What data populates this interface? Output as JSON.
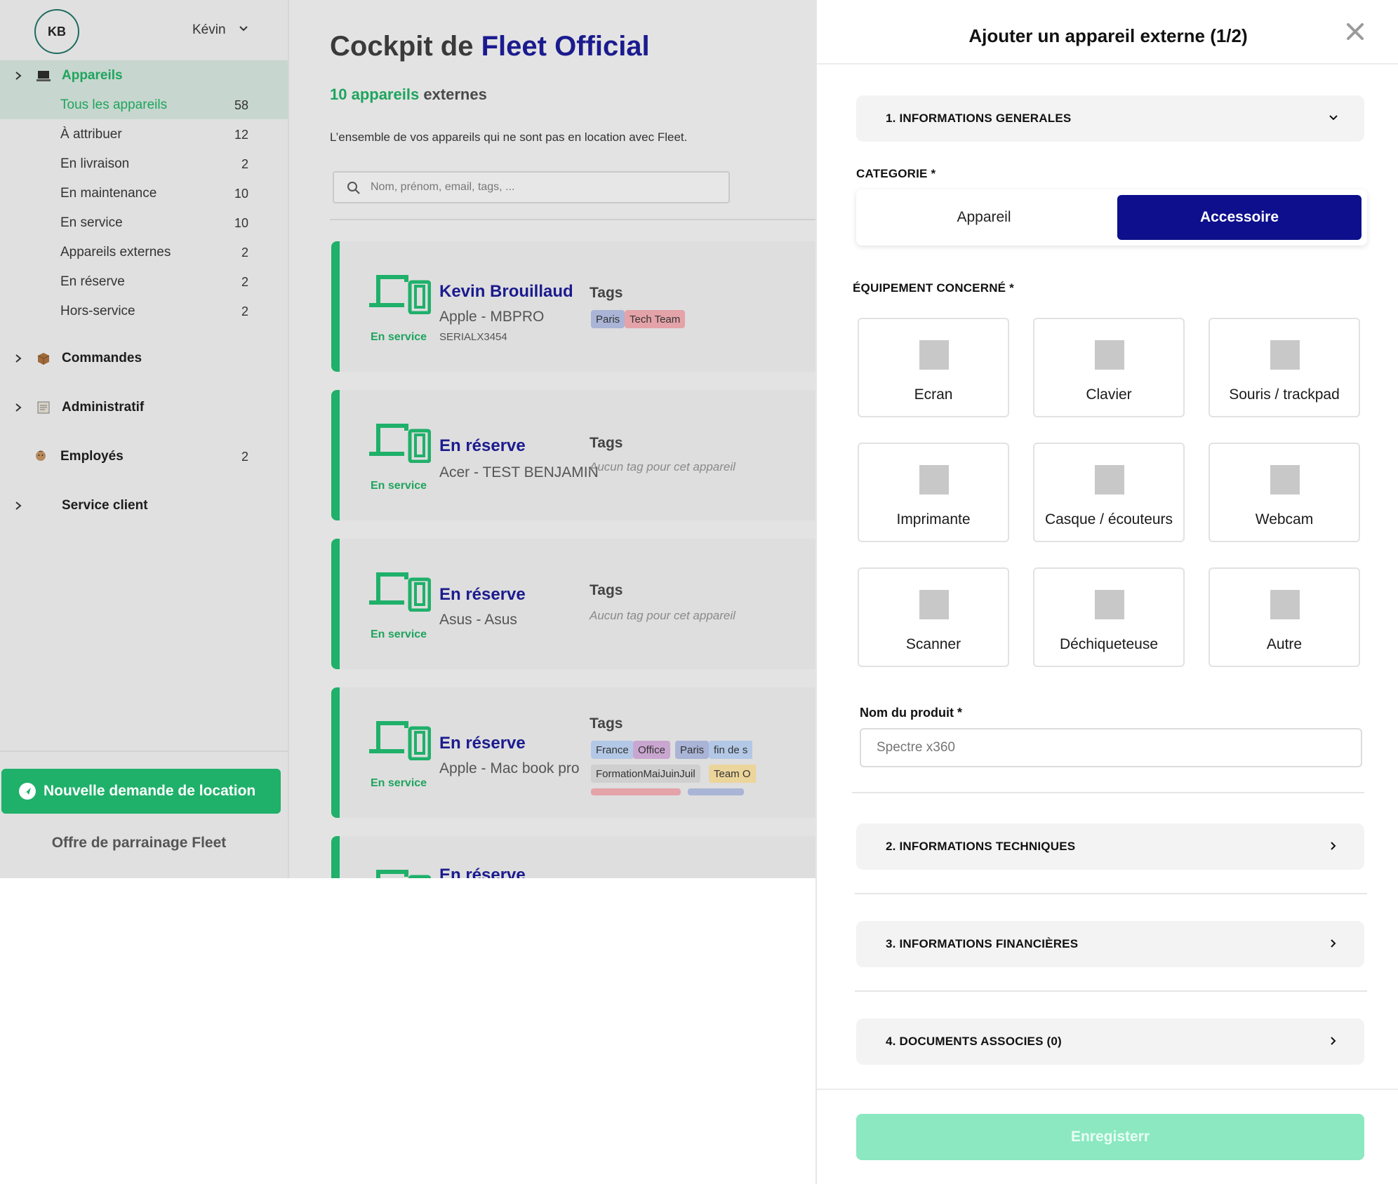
{
  "user": {
    "initials": "KB",
    "name": "Kévin"
  },
  "sidebar": {
    "devices_label": "Appareils",
    "sub_items": [
      {
        "label": "Tous les appareils",
        "count": "58"
      },
      {
        "label": "À attribuer",
        "count": "12"
      },
      {
        "label": "En livraison",
        "count": "2"
      },
      {
        "label": "En maintenance",
        "count": "10"
      },
      {
        "label": "En service",
        "count": "10"
      },
      {
        "label": "Appareils externes",
        "count": "2"
      },
      {
        "label": "En réserve",
        "count": "2"
      },
      {
        "label": "Hors-service",
        "count": "2"
      }
    ],
    "orders_label": "Commandes",
    "admin_label": "Administratif",
    "employees_label": "Employés",
    "employees_count": "2",
    "support_label": "Service client",
    "cta_label": "Nouvelle demande de location",
    "referral_label": "Offre de parrainage Fleet"
  },
  "main": {
    "title_prefix": "Cockpit de",
    "title_brand": "Fleet Official",
    "subtitle_count": "10 appareils",
    "subtitle_rest": "externes",
    "description": "L’ensemble de vos appareils qui ne sont pas en location avec Fleet.",
    "search_placeholder": "Nom, prénom, email, tags, ...",
    "tags_title": "Tags",
    "no_tags": "Aucun tag pour cet appareil",
    "cards": [
      {
        "status": "En service",
        "name": "Kevin Brouillaud",
        "model": "Apple - MBPRO",
        "serial": "SERIALX3454"
      },
      {
        "status": "En service",
        "name": "En réserve",
        "model": "Acer - TEST BENJAMIN"
      },
      {
        "status": "En service",
        "name": "En réserve",
        "model": "Asus - Asus"
      },
      {
        "status": "En service",
        "name": "En réserve",
        "model": "Apple - Mac book pro"
      },
      {
        "name": "En réserve"
      }
    ],
    "card1_tags": [
      "Paris",
      "Tech Team"
    ],
    "card4_tags_row1": [
      "France",
      "Office",
      "Paris",
      "fin de s"
    ],
    "card4_tags_row2": [
      "FormationMaiJuinJuil",
      "Team O"
    ]
  },
  "panel": {
    "title": "Ajouter un appareil externe (1/2)",
    "section1": "1. INFORMATIONS GENERALES",
    "category_label": "CATEGORIE *",
    "category_options": [
      "Appareil",
      "Accessoire"
    ],
    "category_selected": "Accessoire",
    "equipment_label": "ÉQUIPEMENT CONCERNÉ *",
    "equipment": [
      "Ecran",
      "Clavier",
      "Souris / trackpad",
      "Imprimante",
      "Casque / écouteurs",
      "Webcam",
      "Scanner",
      "Déchiqueteuse",
      "Autre"
    ],
    "product_label": "Nom du produit *",
    "product_placeholder": "Spectre x360",
    "section2": "2. INFORMATIONS TECHNIQUES",
    "section3": "3. INFORMATIONS FINANCIÈRES",
    "section4": "4. DOCUMENTS ASSOCIES (0)",
    "save_label": "Enregisterr"
  },
  "colors": {
    "brand_navy": "#0d0f8c",
    "brand_green": "#1fb06a",
    "save_disabled": "#8ce8c1",
    "tag_blue": "#a9b4d6",
    "tag_pink": "#e4a3a9",
    "tag_purple": "#c9a6cf",
    "tag_lightblue": "#b3c8e6",
    "tag_yellow": "#ecd59a"
  }
}
